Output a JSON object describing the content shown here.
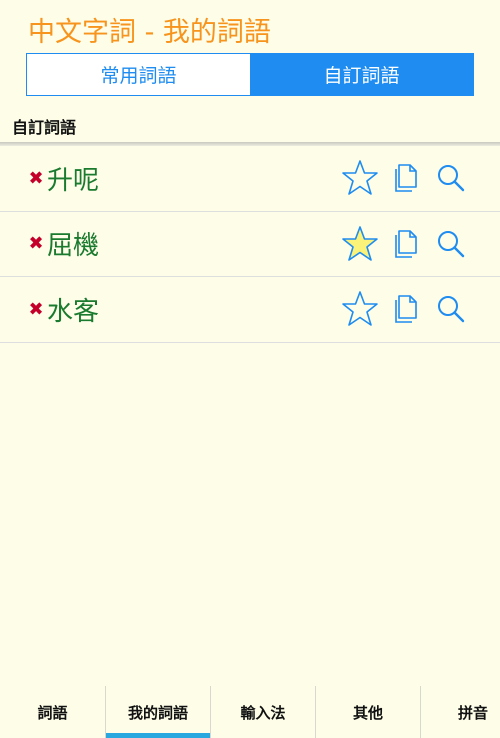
{
  "app": {
    "title": "中文字詞 - 我的詞語"
  },
  "segments": [
    {
      "label": "常用詞語",
      "active": false
    },
    {
      "label": "自訂詞語",
      "active": true
    }
  ],
  "section": {
    "header": "自訂詞語"
  },
  "words": [
    {
      "text": "升呢",
      "starred": false
    },
    {
      "text": "屈機",
      "starred": true
    },
    {
      "text": "水客",
      "starred": false
    }
  ],
  "icons": {
    "delete": "delete-icon",
    "star": "star-icon",
    "copy": "copy-icon",
    "search": "search-icon"
  },
  "colors": {
    "title": "#f7941d",
    "accent": "#1e8cf0",
    "word": "#1a7a2e",
    "delete": "#c4002a",
    "star_fill": "#fbf27a",
    "tab_indicator": "#29a8e0",
    "background": "#fdfde8"
  },
  "tabs": [
    {
      "label": "詞語",
      "active": false
    },
    {
      "label": "我的詞語",
      "active": true
    },
    {
      "label": "輸入法",
      "active": false
    },
    {
      "label": "其他",
      "active": false
    },
    {
      "label": "拼音",
      "active": false
    }
  ]
}
